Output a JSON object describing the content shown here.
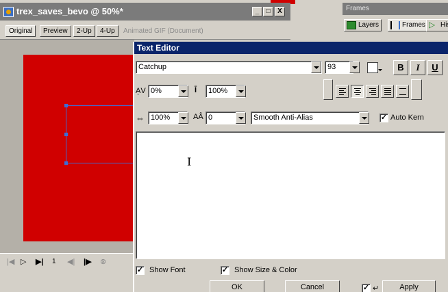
{
  "document": {
    "title": "trex_saves_bevo @ 50%*",
    "tabs": [
      "Original",
      "Preview",
      "2-Up",
      "4-Up"
    ],
    "info": "Animated GIF (Document)",
    "window_buttons": [
      "_",
      "□",
      "X"
    ],
    "playback": {
      "frame_number": "1"
    }
  },
  "panel": {
    "header": "Frames",
    "tabs": [
      "Layers",
      "Frames",
      "His"
    ]
  },
  "text_editor": {
    "title": "Text Editor",
    "font": "Catchup",
    "font_size": "93",
    "bold_label": "B",
    "italic_label": "I",
    "underline_label": "U",
    "kerning": "0%",
    "leading": "100%",
    "horizontal_scale": "100%",
    "baseline_shift": "0",
    "anti_alias": "Smooth Anti-Alias",
    "auto_kern_label": "Auto Kern",
    "auto_kern_checked": true,
    "show_font_label": "Show Font",
    "show_font_checked": true,
    "show_size_color_label": "Show Size & Color",
    "show_size_color_checked": true,
    "ok_label": "OK",
    "cancel_label": "Cancel",
    "apply_label": "Apply",
    "apply_check_checked": true,
    "colors": {
      "title_bar": "#0a246a",
      "canvas_fill": "#d00000",
      "selection": "#3a6fd8"
    }
  }
}
